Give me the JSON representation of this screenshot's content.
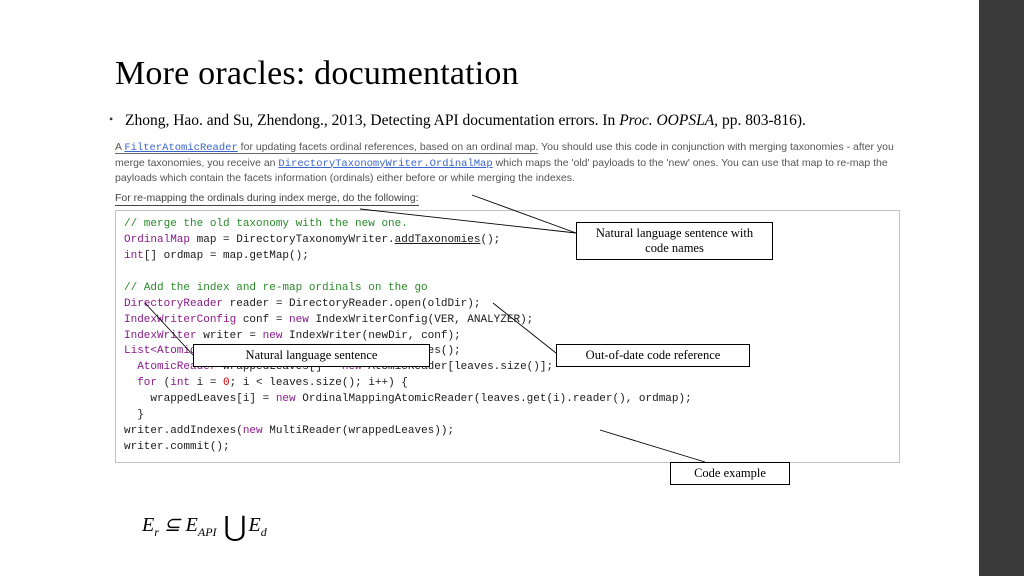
{
  "title": "More oracles: documentation",
  "citation": {
    "authors": "Zhong, Hao. and Su, Zhendong., 2013, Detecting API documentation errors. In ",
    "venue_ital": "Proc. OOPSLA,",
    "pages": " pp. 803-816)."
  },
  "doc": {
    "prose_pre1": "A ",
    "link1": "FilterAtomicReader",
    "prose_pre2": " for updating facets ordinal references, based on an ordinal map.",
    "prose_post": " You should use this code in conjunction with merging taxonomies - after you merge taxonomies, you receive an ",
    "link2": "DirectoryTaxonomyWriter.OrdinalMap",
    "prose_tail": " which maps the 'old' payloads to the 'new' ones. You can use that map to re-map the payloads which contain the facets information (ordinals) either before or while merging the indexes.",
    "intro": "For re-mapping the ordinals during index merge, do the following:"
  },
  "code": {
    "l1": "// merge the old taxonomy with the new one.",
    "l2a": "OrdinalMap",
    "l2b": " map = DirectoryTaxonomyWriter.",
    "l2c": "addTaxonomies",
    "l2d": "();",
    "l3a": "int",
    "l3b": "[] ordmap = map.getMap();",
    "l4": "",
    "l5": "// Add the index and re-map ordinals on the go",
    "l6a": "DirectoryReader",
    "l6b": " reader = DirectoryReader.open(oldDir);",
    "l7a": "IndexWriterConfig",
    "l7b": " conf = ",
    "l7c": "new",
    "l7d": " IndexWriterConfig(VER, ANALYZER);",
    "l8a": "IndexWriter",
    "l8b": " writer = ",
    "l8c": "new",
    "l8d": " IndexWriter(newDir, conf);",
    "l9a": "List<AtomicReaderContext>",
    "l9b": " leaves = reader.leaves();",
    "l10a": "  AtomicReader",
    "l10b": " wrappedLeaves[] = ",
    "l10c": "new",
    "l10d": " AtomicReader[leaves.size()];",
    "l11a": "  for",
    "l11b": " (",
    "l11c": "int",
    "l11d": " i = ",
    "l11e": "0",
    "l11f": "; i < leaves.size(); i++) {",
    "l12a": "    wrappedLeaves[i] = ",
    "l12b": "new",
    "l12c": " OrdinalMappingAtomicReader(leaves.get(i).reader(), ordmap);",
    "l13": "  }",
    "l14a": "writer.addIndexes(",
    "l14b": "new",
    "l14c": " MultiReader(wrappedLeaves));",
    "l15": "writer.commit();"
  },
  "annotations": {
    "a": "Natural language sentence with code names",
    "b": "Out-of-date code reference",
    "c": "Natural language sentence",
    "d": "Code example"
  },
  "formula": {
    "e": "E",
    "r": "r",
    "sub_api": "API",
    "sub_d": "d",
    "subset": " ⊆ ",
    "cup": "⋃"
  }
}
